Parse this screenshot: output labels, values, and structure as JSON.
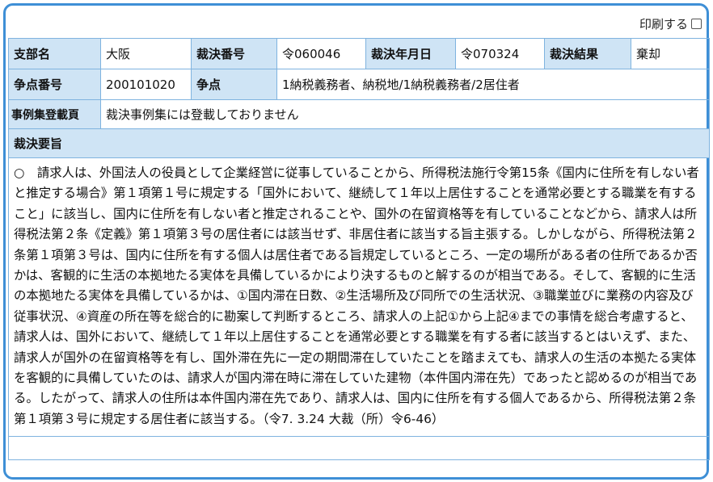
{
  "print": {
    "label": "印刷する"
  },
  "row1": {
    "branch_label": "支部名",
    "branch_value": "大阪",
    "number_label": "裁決番号",
    "number_value": "令060046",
    "date_label": "裁決年月日",
    "date_value": "令070324",
    "result_label": "裁決結果",
    "result_value": "棄却"
  },
  "row2": {
    "issue_no_label": "争点番号",
    "issue_no_value": "200101020",
    "issue_label": "争点",
    "issue_value": "1納税義務者、納税地/1納税義務者/2居住者"
  },
  "row3": {
    "casebook_label": "事例集登載頁",
    "casebook_value": "裁決事例集には登載しておりません"
  },
  "summary": {
    "heading": "裁決要旨",
    "text": "○　請求人は、外国法人の役員として企業経営に従事していることから、所得税法施行令第15条《国内に住所を有しない者と推定する場合》第１項第１号に規定する「国外において、継続して１年以上居住することを通常必要とする職業を有すること」に該当し、国内に住所を有しない者と推定されることや、国外の在留資格等を有していることなどから、請求人は所得税法第２条《定義》第１項第３号の居住者には該当せず、非居住者に該当する旨主張する。しかしながら、所得税法第２条第１項第３号は、国内に住所を有する個人は居住者である旨規定しているところ、一定の場所がある者の住所であるか否かは、客観的に生活の本拠地たる実体を具備しているかにより決するものと解するのが相当である。そして、客観的に生活の本拠地たる実体を具備しているかは、①国内滞在日数、②生活場所及び同所での生活状況、③職業並びに業務の内容及び従事状況、④資産の所在等を総合的に勘案して判断するところ、請求人の上記①から上記④までの事情を総合考慮すると、請求人は、国外において、継続して１年以上居住することを通常必要とする職業を有する者に該当するとはいえず、また、請求人が国外の在留資格等を有し、国外滞在先に一定の期間滞在していたことを踏まえても、請求人の生活の本拠たる実体を客観的に具備していたのは、請求人が国内滞在時に滞在していた建物（本件国内滞在先）であったと認めるのが相当である。したがって、請求人の住所は本件国内滞在先であり、請求人は、国内に住所を有する個人であるから、所得税法第２条第１項第３号に規定する居住者に該当する。（令7. 3.24 大裁（所）令6-46）"
  }
}
